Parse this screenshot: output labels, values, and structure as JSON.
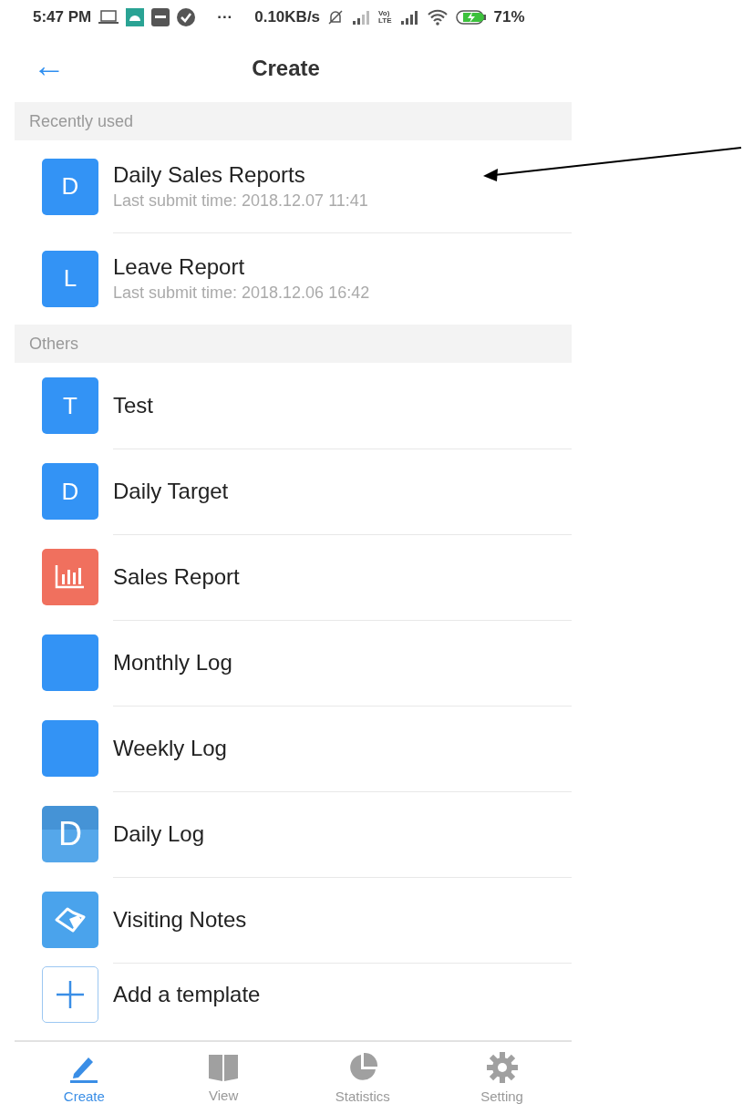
{
  "status_bar": {
    "time": "5:47 PM",
    "more": "···",
    "speed": "0.10KB/s",
    "volte": [
      "Vo)",
      "LTE"
    ],
    "battery": "71%"
  },
  "header": {
    "back": "←",
    "title": "Create"
  },
  "sections": [
    {
      "title": "Recently used",
      "items": [
        {
          "kind": "letter",
          "letter": "D",
          "name": "Daily Sales Reports",
          "subtitle": "Last submit time: 2018.12.07 11:41"
        },
        {
          "kind": "letter",
          "letter": "L",
          "name": "Leave Report",
          "subtitle": "Last submit time: 2018.12.06 16:42"
        }
      ]
    },
    {
      "title": "Others",
      "items": [
        {
          "kind": "letter",
          "letter": "T",
          "name": "Test"
        },
        {
          "kind": "letter",
          "letter": "D",
          "name": "Daily Target"
        },
        {
          "kind": "chart",
          "name": "Sales Report"
        },
        {
          "kind": "blank",
          "name": "Monthly Log"
        },
        {
          "kind": "blank",
          "name": "Weekly Log"
        },
        {
          "kind": "shaded",
          "letter": "D",
          "name": "Daily Log"
        },
        {
          "kind": "handshake",
          "name": "Visiting Notes"
        },
        {
          "kind": "add",
          "name": "Add a template"
        }
      ]
    }
  ],
  "tabs": [
    {
      "kind": "pencil",
      "label": "Create",
      "selected": true
    },
    {
      "kind": "book",
      "label": "View",
      "selected": false
    },
    {
      "kind": "pie",
      "label": "Statistics",
      "selected": false
    },
    {
      "kind": "gear",
      "label": "Setting",
      "selected": false
    }
  ]
}
